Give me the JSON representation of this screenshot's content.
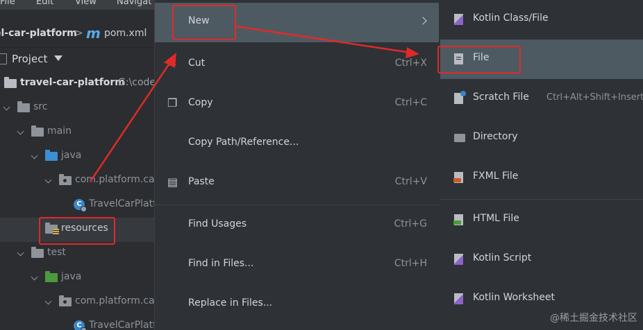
{
  "menubar": {
    "items": [
      "File",
      "Edit",
      "View",
      "Navigat"
    ]
  },
  "breadcrumb": {
    "project": "el-car-platform",
    "separator": ">",
    "file_type_glyph": "m",
    "file": "pom.xml"
  },
  "project_panel": {
    "title": "Project"
  },
  "tree": {
    "root": {
      "name": "travel-car-platform",
      "path": "G:\\code"
    },
    "src": "src",
    "main": "main",
    "java": "java",
    "package": "com.platform.car",
    "main_class": "TravelCarPlatf",
    "resources": "resources",
    "test": "test",
    "test_java": "java",
    "test_package": "com.platform.car",
    "test_class": "TravelCarPlatf"
  },
  "context_menu": {
    "new": "New",
    "cut": "Cut",
    "cut_shortcut": "Ctrl+X",
    "copy": "Copy",
    "copy_shortcut": "Ctrl+C",
    "copy_path": "Copy Path/Reference...",
    "paste": "Paste",
    "paste_shortcut": "Ctrl+V",
    "find_usages": "Find Usages",
    "find_usages_shortcut": "Ctrl+G",
    "find_in_files": "Find in Files...",
    "find_in_files_shortcut": "Ctrl+H",
    "replace_in_files": "Replace in Files..."
  },
  "submenu": {
    "kotlin_class": "Kotlin Class/File",
    "file": "File",
    "scratch_file": "Scratch File",
    "scratch_shortcut": "Ctrl+Alt+Shift+Insert",
    "directory": "Directory",
    "fxml_file": "FXML File",
    "html_file": "HTML File",
    "kotlin_script": "Kotlin Script",
    "kotlin_worksheet": "Kotlin Worksheet"
  },
  "watermark": "@稀土掘金技术社区",
  "colors": {
    "annotation": "#e02a2a",
    "highlight": "#4e5a62",
    "background": "#2b2d30"
  }
}
